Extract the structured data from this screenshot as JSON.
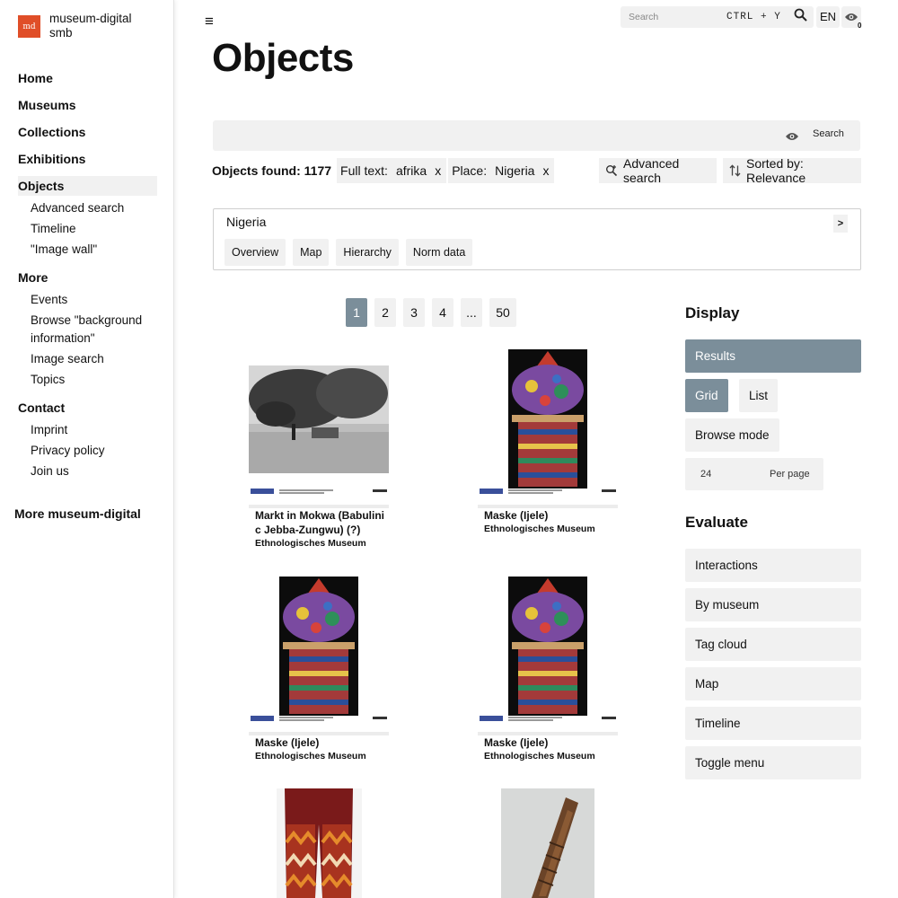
{
  "brand": {
    "logo_text": "md",
    "name": "museum-digital smb"
  },
  "sidebar": {
    "groups": [
      {
        "label": "Home"
      },
      {
        "label": "Museums"
      },
      {
        "label": "Collections"
      },
      {
        "label": "Exhibitions"
      },
      {
        "label": "Objects",
        "active": true,
        "items": [
          "Advanced search",
          "Timeline",
          "\"Image wall\""
        ]
      },
      {
        "label": "More",
        "items": [
          "Events",
          "Browse \"background information\"",
          "Image search",
          "Topics"
        ]
      },
      {
        "label": "Contact",
        "items": [
          "Imprint",
          "Privacy policy",
          "Join us"
        ]
      }
    ],
    "more_link": "More museum-digital"
  },
  "topbar": {
    "menu_icon": "≡",
    "search_placeholder": "Search",
    "shortcut": "CTRL + Y",
    "language": "EN",
    "eye_count": "0"
  },
  "page": {
    "title": "Objects"
  },
  "search": {
    "value": "",
    "button_label": "Search"
  },
  "results": {
    "found_label": "Objects found: 1177",
    "filters": [
      {
        "key": "Full text:",
        "value": "afrika",
        "remove": "x"
      },
      {
        "key": "Place:",
        "value": "Nigeria",
        "remove": "x"
      }
    ],
    "advanced_search_label": "Advanced search",
    "sort_label": "Sorted by: Relevance"
  },
  "place_card": {
    "name": "Nigeria",
    "toggle": ">",
    "tabs": [
      "Overview",
      "Map",
      "Hierarchy",
      "Norm data"
    ]
  },
  "pagination": [
    "1",
    "2",
    "3",
    "4",
    "...",
    "50"
  ],
  "objects": [
    {
      "title": "Markt in Mokwa (Babulini c Jebba-Zungwu) (?)",
      "museum": "Ethnologisches Museum",
      "image": "bw-photo"
    },
    {
      "title": "Maske (Ijele)",
      "museum": "Ethnologisches Museum",
      "image": "mask"
    },
    {
      "title": "Maske (Ijele)",
      "museum": "Ethnologisches Museum",
      "image": "mask"
    },
    {
      "title": "Maske (Ijele)",
      "museum": "Ethnologisches Museum",
      "image": "mask"
    },
    {
      "title": "",
      "museum": "",
      "image": "trousers"
    },
    {
      "title": "",
      "museum": "",
      "image": "carving"
    }
  ],
  "display_panel": {
    "heading": "Display",
    "results_label": "Results",
    "grid_label": "Grid",
    "list_label": "List",
    "browse_label": "Browse mode",
    "per_page_value": "24",
    "per_page_label": "Per page"
  },
  "evaluate_panel": {
    "heading": "Evaluate",
    "items": [
      "Interactions",
      "By museum",
      "Tag cloud",
      "Map",
      "Timeline",
      "Toggle menu"
    ]
  },
  "colors": {
    "brand": "#e04e28",
    "accent": "#7b8e9a",
    "surface": "#f1f1f1"
  }
}
